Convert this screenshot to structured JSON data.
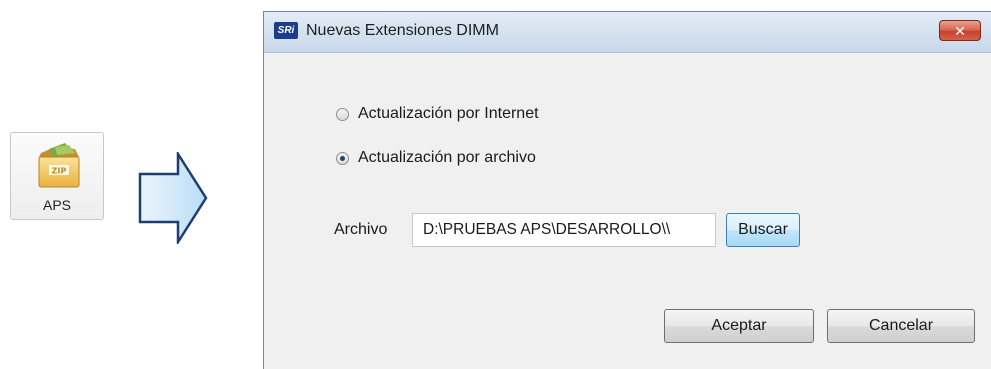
{
  "file": {
    "label": "APS",
    "icon": "zip-folder-icon",
    "icon_text": "ZIP"
  },
  "arrow": {
    "icon": "right-arrow-icon",
    "color": "#cfe6f8"
  },
  "dialog": {
    "title": "Nuevas Extensiones DIMM",
    "app_icon_text": "SRi",
    "close_label": "✕",
    "options": [
      {
        "label": "Actualización por Internet",
        "checked": false
      },
      {
        "label": "Actualización por archivo",
        "checked": true
      }
    ],
    "archivo_label": "Archivo",
    "archivo_value": "D:\\PRUEBAS APS\\DESARROLLO\\\\",
    "buscar_label": "Buscar",
    "aceptar_label": "Aceptar",
    "cancelar_label": "Cancelar"
  }
}
